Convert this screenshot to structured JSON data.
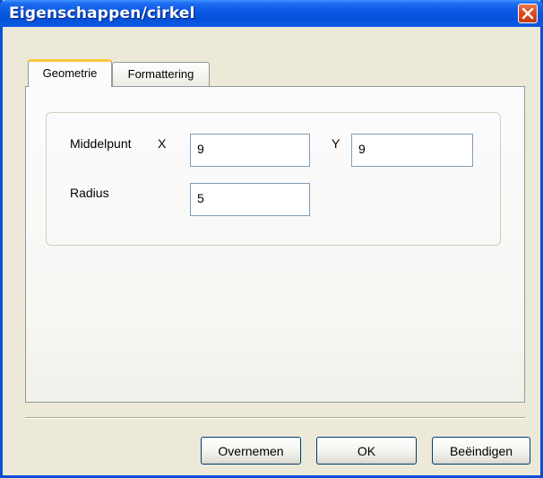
{
  "window": {
    "title": "Eigenschappen/cirkel"
  },
  "tabs": [
    {
      "label": "Geometrie",
      "active": true
    },
    {
      "label": "Formattering",
      "active": false
    }
  ],
  "geometry": {
    "center_label": "Middelpunt",
    "x_label": "X",
    "x_value": "9",
    "y_label": "Y",
    "y_value": "9",
    "radius_label": "Radius",
    "radius_value": "5"
  },
  "buttons": {
    "apply": "Overnemen",
    "ok": "OK",
    "close": "Beëindigen"
  },
  "icons": {
    "close": "close-icon"
  },
  "colors": {
    "titlebar": "#0a58e4",
    "close_button": "#d94a1e",
    "active_tab_highlight": "#ffc83c",
    "window_bg": "#ece9d8"
  }
}
